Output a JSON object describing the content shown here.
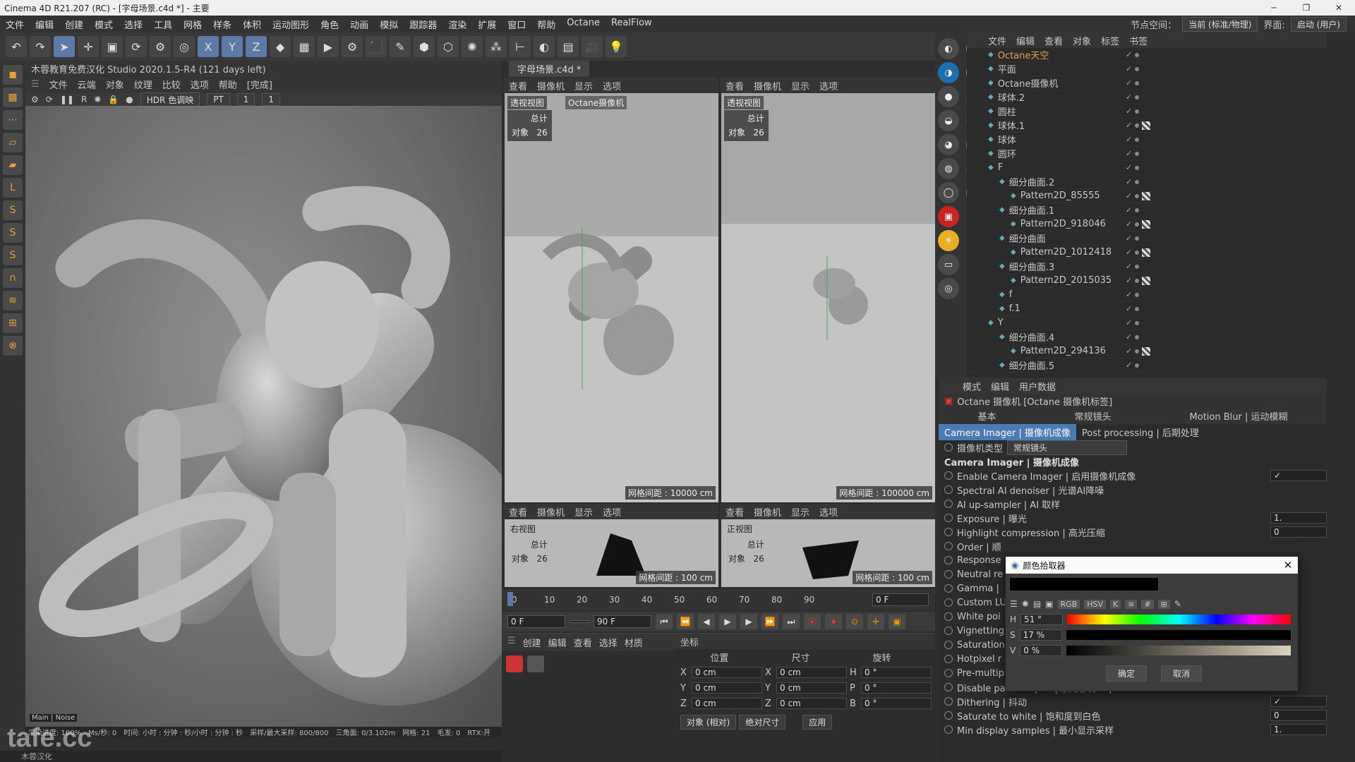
{
  "titlebar": {
    "title": "Cinema 4D R21.207 (RC) - [字母场景.c4d *] - 主要"
  },
  "menu": [
    "文件",
    "编辑",
    "创建",
    "模式",
    "选择",
    "工具",
    "网格",
    "样条",
    "体积",
    "运动图形",
    "角色",
    "动画",
    "模拟",
    "跟踪器",
    "渲染",
    "扩展",
    "窗口",
    "帮助",
    "Octane",
    "RealFlow"
  ],
  "menu_right": {
    "node_label": "节点空间：",
    "node_value": "当前 (标准/物理)",
    "layout_label": "界面:",
    "layout_value": "启动 (用户)"
  },
  "live_viewer": {
    "title": "木蓉教育免费汉化 Studio 2020.1.5-R4 (121 days left)",
    "menu": [
      "文件",
      "云端",
      "对象",
      "纹理",
      "比较",
      "选项",
      "帮助"
    ],
    "status": "[完成]",
    "hdr": "HDR 色调映",
    "mode": "PT",
    "v1": "1",
    "v2": "1",
    "tabs": [
      "Main",
      "Noise"
    ],
    "stats": [
      "渲染进度: 100%",
      "Ms/秒: 0",
      "时间: 小时 : 分钟 : 秒/小时 : 分钟 : 秒",
      "采样/最大采样: 800/800",
      "三角面: 0/3.102m",
      "网格: 21",
      "毛发: 0",
      "RTX:开"
    ]
  },
  "doc_tab": "字母场景.c4d *",
  "vp_menu": [
    "查看",
    "摄像机",
    "显示",
    "选项"
  ],
  "viewports": [
    {
      "label": "透视视图",
      "camera": "Octane摄像机",
      "total": "总计",
      "obj": "对象",
      "count": "26",
      "grid": "网格间距 : 10000 cm"
    },
    {
      "label": "透视视图",
      "total": "总计",
      "obj": "对象",
      "count": "26",
      "grid": "网格间距 : 100000 cm"
    },
    {
      "label": "右视图",
      "total": "总计",
      "obj": "对象",
      "count": "26",
      "grid": "网格间距 : 100 cm"
    },
    {
      "label": "正视图",
      "total": "总计",
      "obj": "对象",
      "count": "26",
      "grid": "网格间距 : 100 cm"
    }
  ],
  "timeline": {
    "ticks": [
      "0",
      "10",
      "20",
      "30",
      "40",
      "50",
      "60",
      "70",
      "80",
      "90"
    ],
    "current": "0 F",
    "start": "0 F",
    "end": "90 F"
  },
  "materials": {
    "menu": [
      "创建",
      "编辑",
      "查看",
      "选择",
      "材质"
    ]
  },
  "coords": {
    "title": "坐标",
    "cols": [
      "位置",
      "尺寸",
      "旋转"
    ],
    "rows": [
      {
        "a": "X",
        "av": "0 cm",
        "b": "X",
        "bv": "0 cm",
        "c": "H",
        "cv": "0 °"
      },
      {
        "a": "Y",
        "av": "0 cm",
        "b": "Y",
        "bv": "0 cm",
        "c": "P",
        "cv": "0 °"
      },
      {
        "a": "Z",
        "av": "0 cm",
        "b": "Z",
        "bv": "0 cm",
        "c": "B",
        "cv": "0 °"
      }
    ],
    "mode1": "对象 (相对)",
    "mode2": "绝对尺寸",
    "apply": "应用"
  },
  "objmgr": {
    "menu": [
      "文件",
      "编辑",
      "查看",
      "对象",
      "标签",
      "书签"
    ],
    "items": [
      {
        "name": "Octane天空",
        "indent": 0,
        "color": "#e8a040"
      },
      {
        "name": "平面",
        "indent": 0
      },
      {
        "name": "Octane摄像机",
        "indent": 0
      },
      {
        "name": "球体.2",
        "indent": 0
      },
      {
        "name": "圆柱",
        "indent": 0
      },
      {
        "name": "球体.1",
        "indent": 0
      },
      {
        "name": "球体",
        "indent": 0
      },
      {
        "name": "圆环",
        "indent": 0
      },
      {
        "name": "F",
        "indent": 0
      },
      {
        "name": "细分曲面.2",
        "indent": 1
      },
      {
        "name": "Pattern2D_85555",
        "indent": 2
      },
      {
        "name": "细分曲面.1",
        "indent": 1
      },
      {
        "name": "Pattern2D_918046",
        "indent": 2
      },
      {
        "name": "细分曲面",
        "indent": 1
      },
      {
        "name": "Pattern2D_1012418",
        "indent": 2
      },
      {
        "name": "细分曲面.3",
        "indent": 1
      },
      {
        "name": "Pattern2D_2015035",
        "indent": 2
      },
      {
        "name": "f",
        "indent": 1
      },
      {
        "name": "f.1",
        "indent": 1
      },
      {
        "name": "Y",
        "indent": 0
      },
      {
        "name": "细分曲面.4",
        "indent": 1
      },
      {
        "name": "Pattern2D_294136",
        "indent": 2
      },
      {
        "name": "细分曲面.5",
        "indent": 1
      }
    ]
  },
  "attr": {
    "menu": [
      "模式",
      "编辑",
      "用户数据"
    ],
    "header": "Octane 摄像机 [Octane 摄像机标签]",
    "tabs1": [
      "基本",
      "常规镜头",
      "Motion Blur | 运动模糊"
    ],
    "tabs2": [
      "Camera Imager | 摄像机成像",
      "Post processing | 后期处理"
    ],
    "cam_type_label": "摄像机类型",
    "cam_type": "常规镜头",
    "section": "Camera Imager | 摄像机成像",
    "rows": [
      {
        "label": "Enable Camera Imager | 启用摄像机成像",
        "val": "✓"
      },
      {
        "label": "Spectral AI denoiser | 光谱AI降噪",
        "val": ""
      },
      {
        "label": "AI up-sampler | AI 取样",
        "val": ""
      },
      {
        "label": "Exposure | 曝光",
        "val": "1."
      },
      {
        "label": "Highlight compression | 高光压缩",
        "val": "0"
      },
      {
        "label": "Order | 顺",
        "val": ""
      },
      {
        "label": "Response",
        "val": ""
      },
      {
        "label": "Neutral re",
        "val": ""
      },
      {
        "label": "Gamma |",
        "val": ""
      },
      {
        "label": "Custom LU",
        "val": ""
      },
      {
        "label": "White poi",
        "val": ""
      },
      {
        "label": "Vignetting",
        "val": ""
      },
      {
        "label": "Saturation",
        "val": ""
      },
      {
        "label": "Hotpixel r",
        "val": ""
      },
      {
        "label": "Pre-multip",
        "val": ""
      },
      {
        "label": "Disable partial alpha | 禁用部分 Alpha",
        "val": ""
      },
      {
        "label": "Dithering | 抖动",
        "val": "✓"
      },
      {
        "label": "Saturate to white | 饱和度到白色",
        "val": "0"
      },
      {
        "label": "Min display samples | 最小显示采样",
        "val": "1."
      }
    ]
  },
  "picker": {
    "title": "颜色拾取器",
    "h": "51 °",
    "s": "17 %",
    "v": "0 %",
    "ok": "确定",
    "cancel": "取消",
    "modes": [
      "RGB",
      "HSV",
      "K",
      "≡",
      "#",
      "⊞"
    ]
  },
  "watermark": "tafe.cc",
  "status": "木蓉汉化"
}
